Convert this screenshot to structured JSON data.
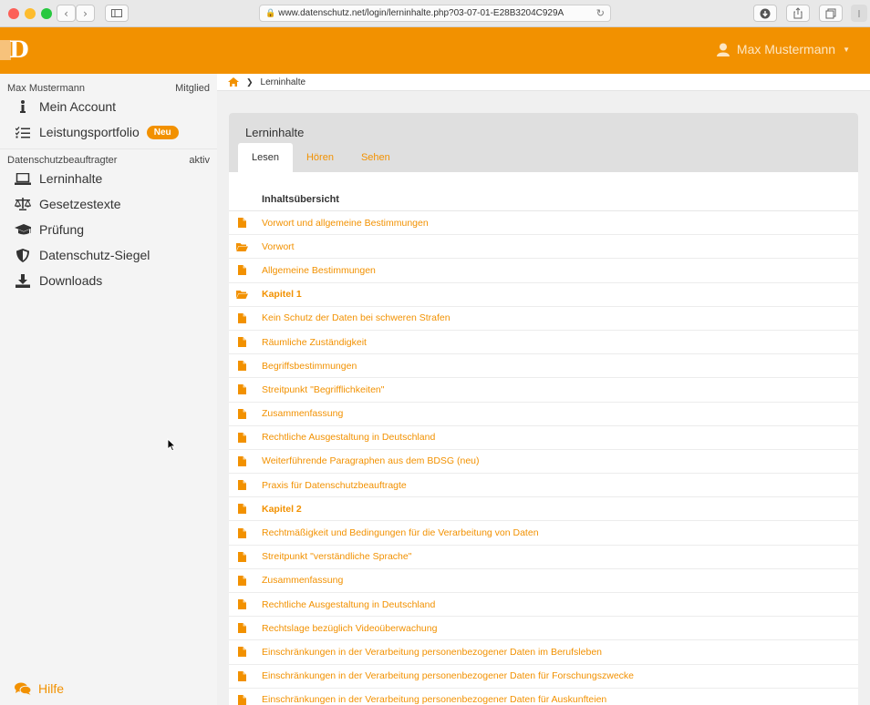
{
  "browser": {
    "url": "www.datenschutz.net/login/lerninhalte.php?03-07-01-E28B3204C929A"
  },
  "header": {
    "logo_letter": "D",
    "user_name": "Max Mustermann"
  },
  "sidebar": {
    "section1": {
      "name": "Max Mustermann",
      "status": "Mitglied"
    },
    "section1_items": [
      {
        "label": "Mein Account",
        "icon": "info-icon"
      },
      {
        "label": "Leistungsportfolio",
        "icon": "checklist-icon",
        "badge": "Neu"
      }
    ],
    "section2": {
      "name": "Datenschutzbeauftragter",
      "status": "aktiv"
    },
    "section2_items": [
      {
        "label": "Lerninhalte",
        "icon": "laptop-icon"
      },
      {
        "label": "Gesetzestexte",
        "icon": "scale-icon"
      },
      {
        "label": "Prüfung",
        "icon": "graduation-cap-icon"
      },
      {
        "label": "Datenschutz-Siegel",
        "icon": "shield-icon"
      },
      {
        "label": "Downloads",
        "icon": "download-icon"
      }
    ],
    "help_label": "Hilfe"
  },
  "breadcrumb": {
    "current": "Lerninhalte"
  },
  "panel": {
    "title": "Lerninhalte",
    "tabs": [
      "Lesen",
      "Hören",
      "Sehen"
    ],
    "toc_header": "Inhaltsübersicht",
    "rows": [
      {
        "label": "Vorwort und allgemeine Bestimmungen",
        "icon": "file"
      },
      {
        "label": "Vorwort",
        "icon": "folder"
      },
      {
        "label": "Allgemeine Bestimmungen",
        "icon": "file"
      },
      {
        "label": "Kapitel 1",
        "icon": "folder",
        "bold": true
      },
      {
        "label": "Kein Schutz der Daten bei schweren Strafen",
        "icon": "file"
      },
      {
        "label": "Räumliche Zuständigkeit",
        "icon": "file"
      },
      {
        "label": "Begriffsbestimmungen",
        "icon": "file"
      },
      {
        "label": "Streitpunkt \"Begrifflichkeiten\"",
        "icon": "file"
      },
      {
        "label": "Zusammenfassung",
        "icon": "file"
      },
      {
        "label": "Rechtliche Ausgestaltung in Deutschland",
        "icon": "file"
      },
      {
        "label": "Weiterführende Paragraphen aus dem BDSG (neu)",
        "icon": "file"
      },
      {
        "label": "Praxis für Datenschutzbeauftragte",
        "icon": "file"
      },
      {
        "label": "Kapitel 2",
        "icon": "file",
        "bold": true
      },
      {
        "label": "Rechtmäßigkeit und Bedingungen für die Verarbeitung von Daten",
        "icon": "file"
      },
      {
        "label": "Streitpunkt \"verständliche Sprache\"",
        "icon": "file"
      },
      {
        "label": "Zusammenfassung",
        "icon": "file"
      },
      {
        "label": "Rechtliche Ausgestaltung in Deutschland",
        "icon": "file"
      },
      {
        "label": "Rechtslage bezüglich Videoüberwachung",
        "icon": "file"
      },
      {
        "label": "Einschränkungen in der Verarbeitung personenbezogener Daten im Berufsleben",
        "icon": "file"
      },
      {
        "label": "Einschränkungen in der Verarbeitung personenbezogener Daten für Forschungszwecke",
        "icon": "file"
      },
      {
        "label": "Einschränkungen in der Verarbeitung personenbezogener Daten für Auskunfteien",
        "icon": "file"
      }
    ]
  },
  "colors": {
    "accent": "#f29100",
    "header_bg": "#f29100",
    "sidebar_bg": "#f4f4f4",
    "panel_head_bg": "#dfdfdf"
  }
}
